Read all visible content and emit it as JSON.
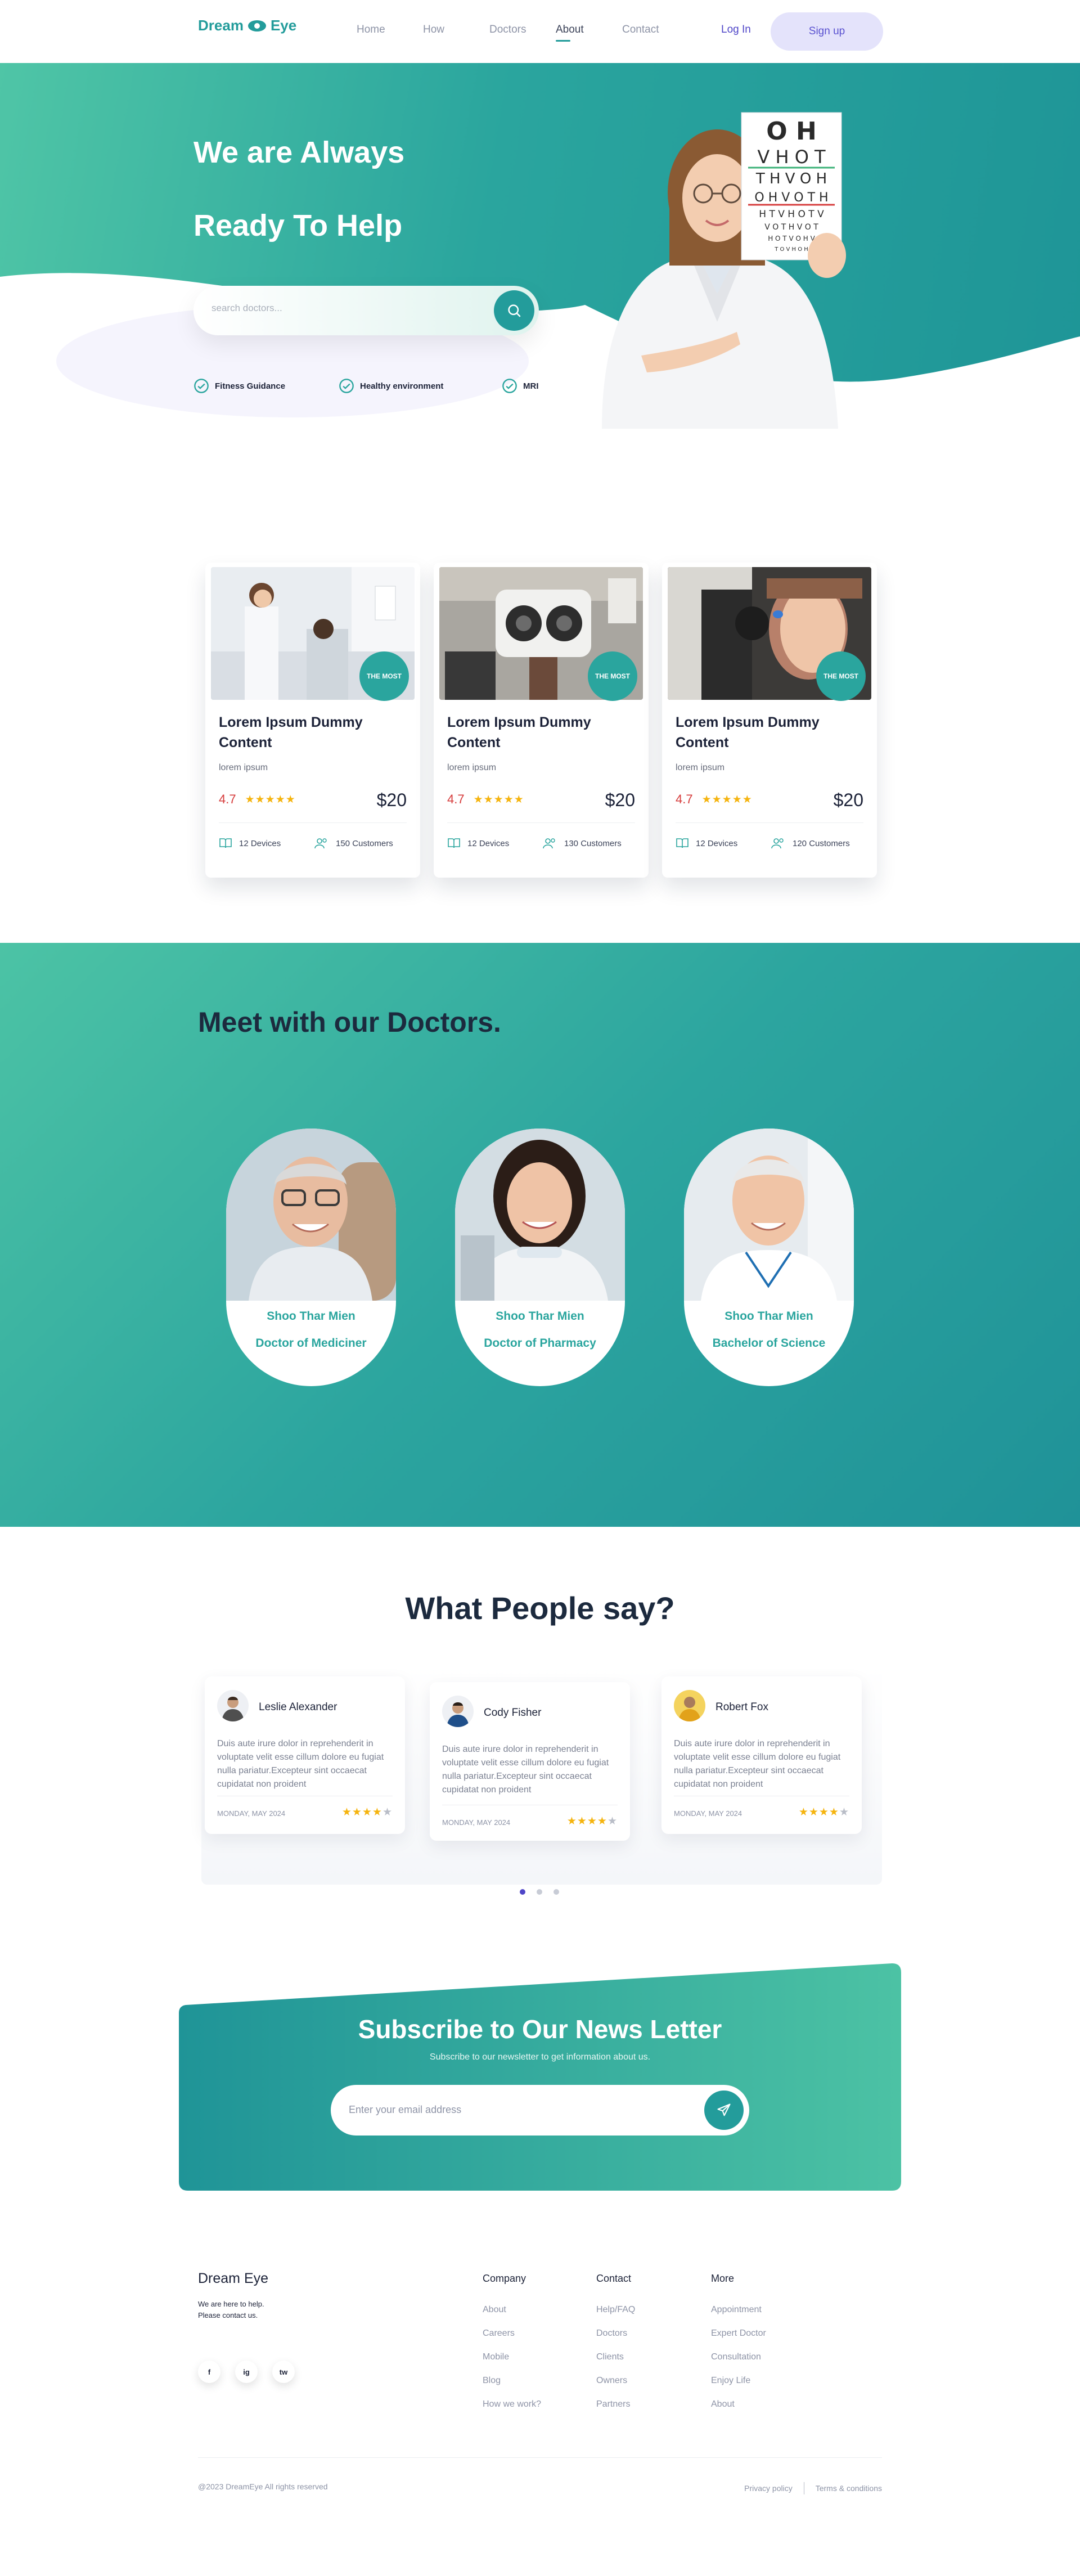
{
  "brand": {
    "name": "Dream Eye",
    "accent": "#239c9b"
  },
  "nav": {
    "links": [
      "Home",
      "How",
      "Doctors",
      "About",
      "Contact"
    ],
    "active": "About",
    "login": "Log In",
    "signup": "Sign up"
  },
  "hero": {
    "title_line1": "We are Always",
    "title_line2": "Ready To Help",
    "search_placeholder": "search doctors...",
    "features": [
      "Fitness Guidance",
      "Healthy environment",
      "MRI"
    ],
    "eye_chart_rows": [
      "O H",
      "V H O T",
      "T H V O H",
      "O H V O T H",
      "H T V H O T V",
      "V O T H V O T",
      "H O T V O H V",
      "T O V H O H"
    ]
  },
  "cards": [
    {
      "badge": "THE MOST",
      "title": "Lorem Ipsum Dummy Content",
      "subtitle": "lorem ipsum",
      "rating": "4.7",
      "stars": 5,
      "price": "$20",
      "devices": "12 Devices",
      "customers": "150 Customers"
    },
    {
      "badge": "THE MOST",
      "title": "Lorem Ipsum Dummy Content",
      "subtitle": "lorem ipsum",
      "rating": "4.7",
      "stars": 5,
      "price": "$20",
      "devices": "12 Devices",
      "customers": "130 Customers"
    },
    {
      "badge": "THE MOST",
      "title": "Lorem Ipsum Dummy Content",
      "subtitle": "lorem ipsum",
      "rating": "4.7",
      "stars": 5,
      "price": "$20",
      "devices": "12 Devices",
      "customers": "120 Customers"
    }
  ],
  "doctors": {
    "title": "Meet with our Doctors.",
    "items": [
      {
        "name": "Shoo Thar Mien",
        "title": "Doctor of Mediciner"
      },
      {
        "name": "Shoo Thar Mien",
        "title": "Doctor of Pharmacy"
      },
      {
        "name": "Shoo Thar Mien",
        "title": "Bachelor of Science"
      }
    ]
  },
  "testimonials": {
    "title": "What People say?",
    "items": [
      {
        "name": "Leslie Alexander",
        "text": "Duis aute irure dolor in reprehenderit in voluptate velit esse cillum dolore eu fugiat nulla pariatur.Excepteur sint occaecat cupidatat non proident",
        "date": "MONDAY, MAY 2024",
        "rating": 4
      },
      {
        "name": "Cody Fisher",
        "text": "Duis aute irure dolor in reprehenderit in voluptate velit esse cillum dolore eu fugiat nulla pariatur.Excepteur sint occaecat cupidatat non proident",
        "date": "MONDAY, MAY 2024",
        "rating": 4
      },
      {
        "name": "Robert Fox",
        "text": "Duis aute irure dolor in reprehenderit in voluptate velit esse cillum dolore eu fugiat nulla pariatur.Excepteur sint occaecat cupidatat non proident",
        "date": "MONDAY, MAY 2024",
        "rating": 4
      }
    ],
    "pages": 3,
    "active_page": 1
  },
  "subscribe": {
    "title": "Subscribe to Our News Letter",
    "text": "Subscribe to our newsletter to get information about us.",
    "placeholder": "Enter your email address"
  },
  "footer": {
    "brand": "Dream Eye",
    "tagline_line1": "We are here to help.",
    "tagline_line2": "Please contact us.",
    "socials": [
      "f",
      "ig",
      "tw"
    ],
    "columns": [
      {
        "title": "Company",
        "links": [
          "About",
          "Careers",
          "Mobile",
          "Blog",
          "How we work?"
        ]
      },
      {
        "title": "Contact",
        "links": [
          "Help/FAQ",
          "Doctors",
          "Clients",
          "Owners",
          "Partners"
        ]
      },
      {
        "title": "More",
        "links": [
          "Appointment",
          "Expert Doctor",
          "Consultation",
          "Enjoy Life",
          "About"
        ]
      }
    ],
    "copyright": "@2023 DreamEye All rights reserved",
    "privacy": "Privacy policy",
    "terms": "Terms & conditions"
  }
}
